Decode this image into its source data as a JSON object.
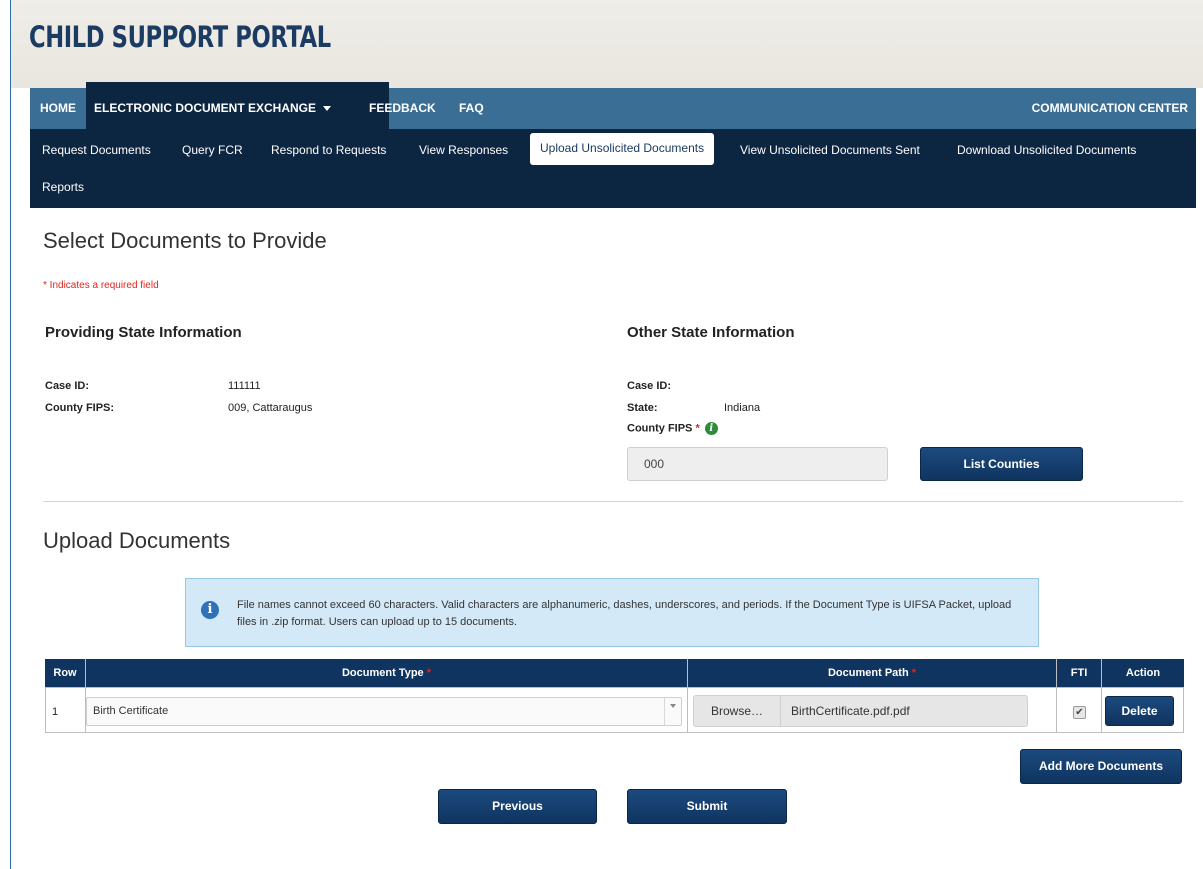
{
  "header": {
    "title": "CHILD SUPPORT PORTAL"
  },
  "nav": {
    "home": "HOME",
    "ede": "ELECTRONIC DOCUMENT EXCHANGE",
    "feedback": "FEEDBACK",
    "faq": "FAQ",
    "comm_center": "COMMUNICATION CENTER"
  },
  "subnav": {
    "request_documents": "Request Documents",
    "query_fcr": "Query FCR",
    "respond_to_requests": "Respond to Requests",
    "view_responses": "View Responses",
    "upload_unsolicited": "Upload Unsolicited Documents",
    "view_unsolicited_sent": "View Unsolicited Documents Sent",
    "download_unsolicited": "Download Unsolicited Documents",
    "reports": "Reports"
  },
  "page": {
    "title": "Select Documents to Provide",
    "required_note": "* Indicates a required field"
  },
  "providing_state": {
    "heading": "Providing State Information",
    "case_id_label": "Case ID:",
    "case_id_value": "111111",
    "county_fips_label": "County FIPS:",
    "county_fips_value": "009, Cattaraugus"
  },
  "other_state": {
    "heading": "Other State Information",
    "case_id_label": "Case ID:",
    "state_label": "State:",
    "state_value": "Indiana",
    "county_fips_label": "County FIPS",
    "required_marker": "*",
    "county_fips_value": "000",
    "list_counties_button": "List Counties"
  },
  "upload": {
    "heading": "Upload Documents",
    "info_text": "File names cannot exceed 60 characters. Valid characters are alphanumeric, dashes, underscores, and periods. If the Document Type is UIFSA Packet, upload files in .zip format. Users can upload up to 15 documents.",
    "columns": {
      "row": "Row",
      "document_type": "Document Type",
      "document_path": "Document Path",
      "fti": "FTI",
      "action": "Action"
    },
    "required_marker": "*",
    "rows": [
      {
        "row": "1",
        "document_type": "Birth Certificate",
        "browse_label": "Browse…",
        "document_path": "BirthCertificate.pdf.pdf",
        "fti_checked": true,
        "action_label": "Delete"
      }
    ],
    "add_more_button": "Add More Documents"
  },
  "footer_buttons": {
    "previous": "Previous",
    "submit": "Submit"
  },
  "colors": {
    "nav_top": "#3b6e94",
    "nav_dark": "#0c2540",
    "button": "#0f3460",
    "required": "#e0241c",
    "info_bg": "#d3e9f8"
  }
}
